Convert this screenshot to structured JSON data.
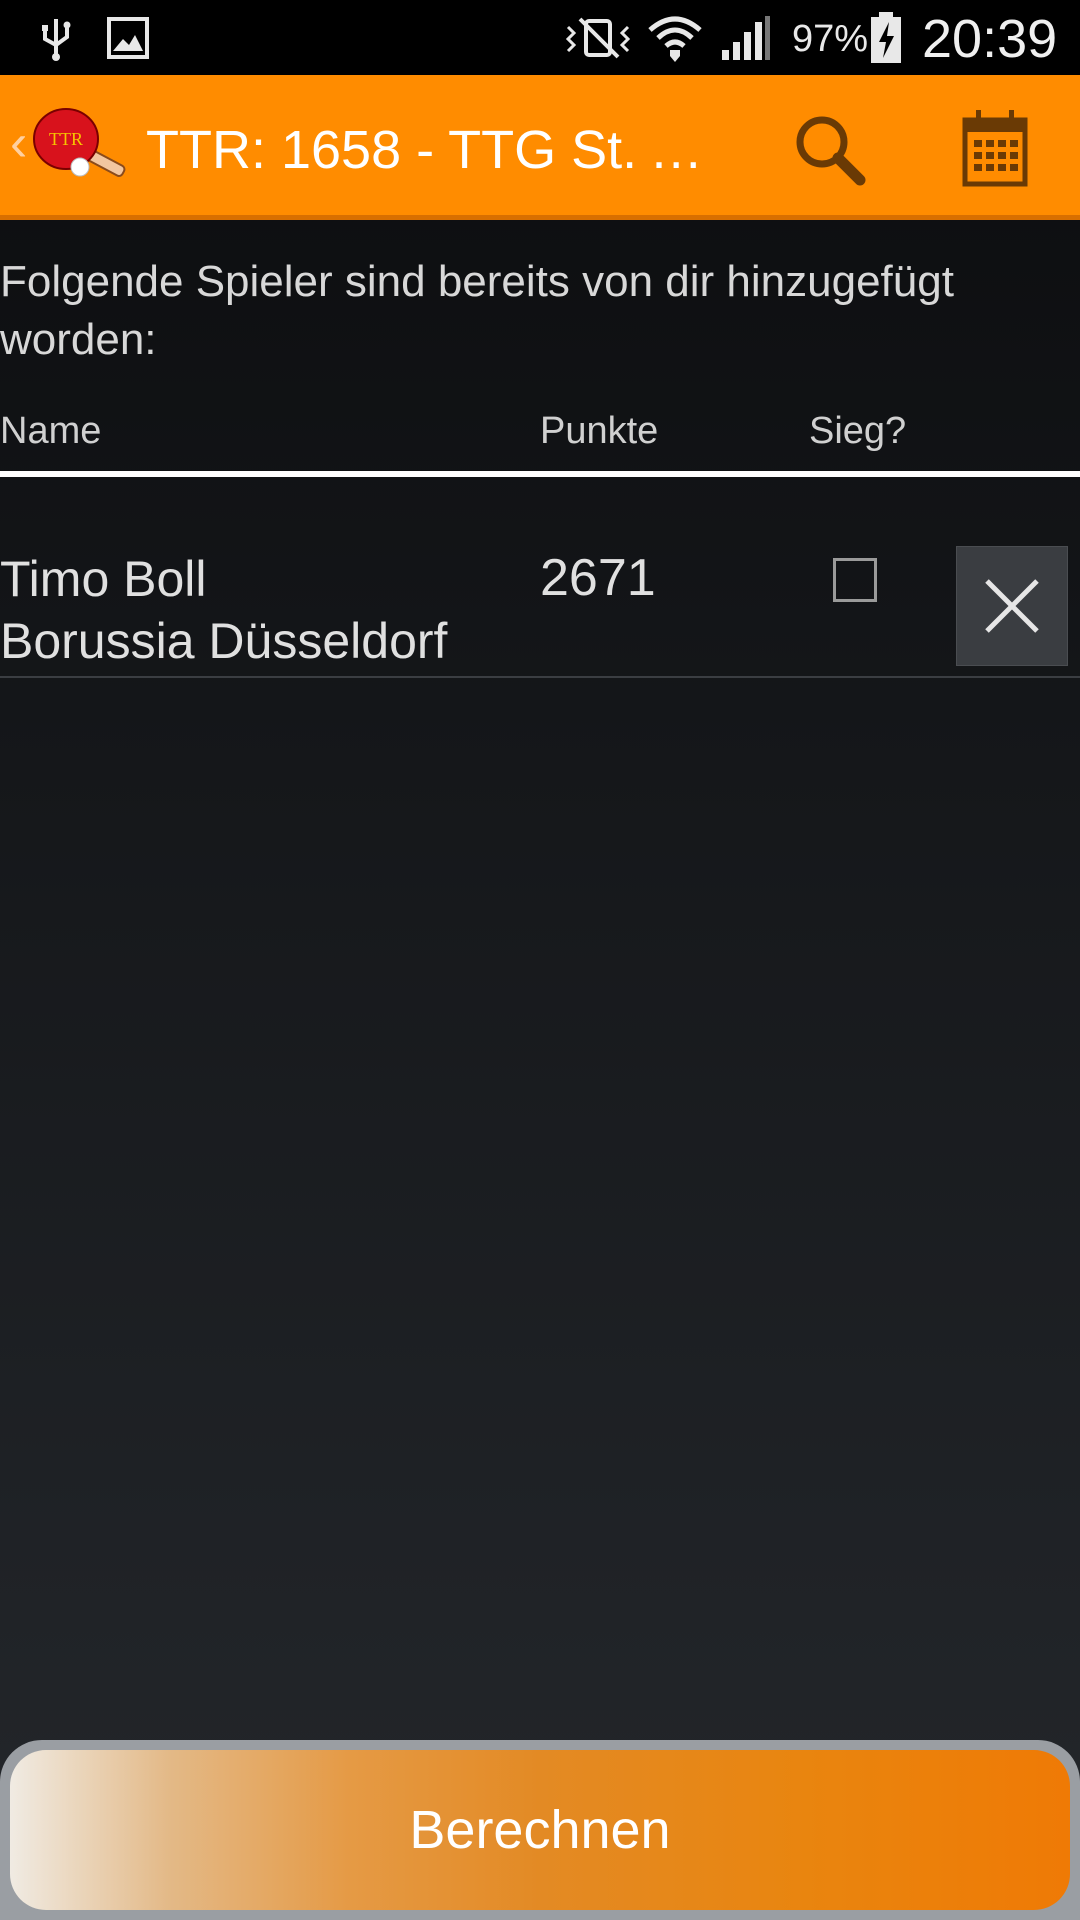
{
  "status_bar": {
    "battery_percent": "97%",
    "time": "20:39",
    "icons": [
      "usb-icon",
      "image-icon",
      "vibrate-off-icon",
      "wifi-icon",
      "signal-icon",
      "battery-charging-icon"
    ]
  },
  "action_bar": {
    "title": "TTR: 1658 - TTG St. Au...",
    "logo_text": "TTR",
    "icons": [
      "back-icon",
      "app-logo-icon",
      "search-icon",
      "calendar-icon"
    ],
    "color": "#ff8c00"
  },
  "content": {
    "intro_text": "Folgende Spieler sind bereits von dir hinzugefügt worden:",
    "columns": {
      "name": "Name",
      "points": "Punkte",
      "win": "Sieg?"
    },
    "players": [
      {
        "name": "Timo Boll",
        "club": "Borussia Düsseldorf",
        "points": "2671",
        "win_checked": false
      }
    ]
  },
  "footer": {
    "calculate_label": "Berechnen"
  }
}
